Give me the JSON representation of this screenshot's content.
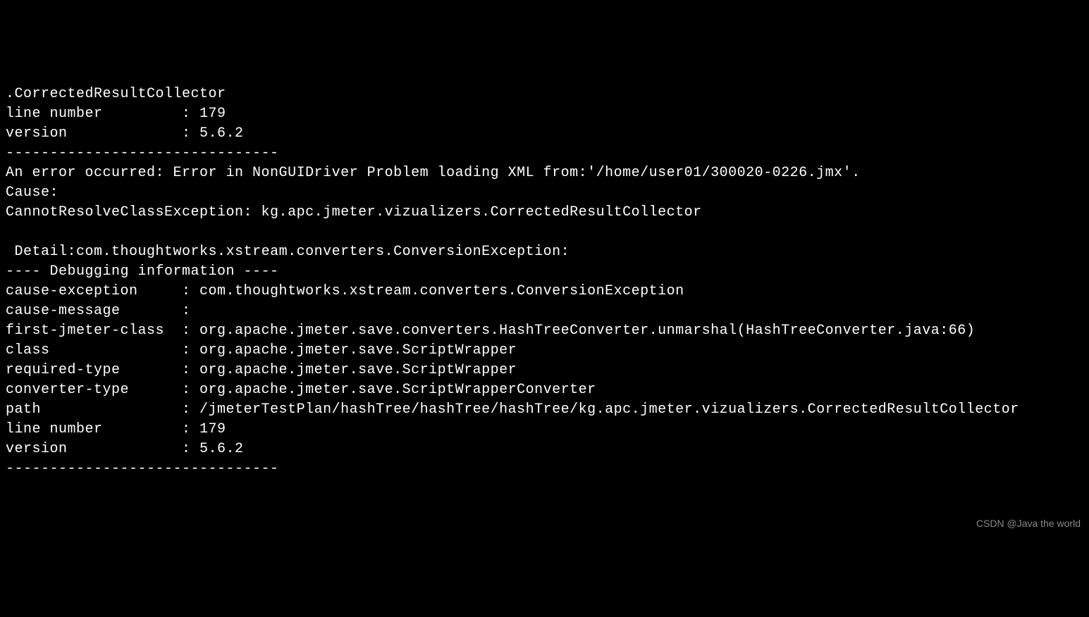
{
  "terminal": {
    "line01": ".CorrectedResultCollector",
    "line02": "line number         : 179",
    "line03": "version             : 5.6.2",
    "line04": "-------------------------------",
    "line05": "An error occurred: Error in NonGUIDriver Problem loading XML from:'/home/user01/300020-0226.jmx'.",
    "line06": "Cause:",
    "line07": "CannotResolveClassException: kg.apc.jmeter.vizualizers.CorrectedResultCollector",
    "line08": "",
    "line09": " Detail:com.thoughtworks.xstream.converters.ConversionException:",
    "line10": "---- Debugging information ----",
    "line11": "cause-exception     : com.thoughtworks.xstream.converters.ConversionException",
    "line12": "cause-message       :",
    "line13": "first-jmeter-class  : org.apache.jmeter.save.converters.HashTreeConverter.unmarshal(HashTreeConverter.java:66)",
    "line14": "class               : org.apache.jmeter.save.ScriptWrapper",
    "line15": "required-type       : org.apache.jmeter.save.ScriptWrapper",
    "line16": "converter-type      : org.apache.jmeter.save.ScriptWrapperConverter",
    "line17": "path                : /jmeterTestPlan/hashTree/hashTree/hashTree/kg.apc.jmeter.vizualizers.CorrectedResultCollector",
    "line18": "line number         : 179",
    "line19": "version             : 5.6.2",
    "line20": "-------------------------------"
  },
  "watermark": "CSDN @Java the world"
}
